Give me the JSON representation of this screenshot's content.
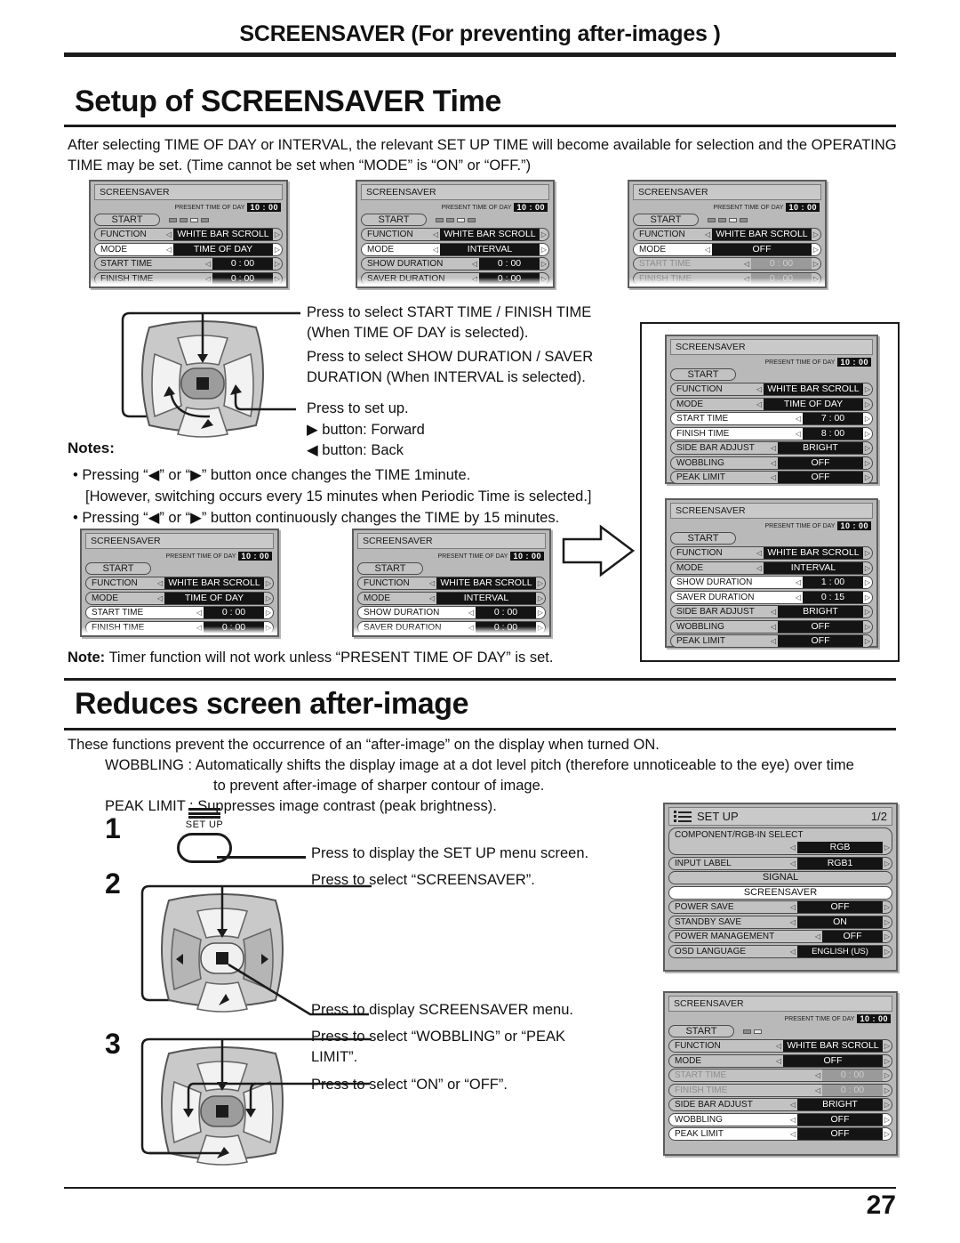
{
  "header": {
    "title": "SCREENSAVER (For preventing after-images )"
  },
  "section1": {
    "heading": "Setup of SCREENSAVER Time",
    "intro": "After selecting TIME OF DAY or INTERVAL, the relevant SET UP TIME will become available for selection and the OPERATING TIME may be set. (Time cannot be set when “MODE” is “ON” or “OFF.”)",
    "callouts": {
      "c1": "Press to select START TIME / FINISH TIME (When TIME OF DAY  is selected).",
      "c2": "Press to select SHOW DURATION / SAVER DURATION (When INTERVAL  is selected).",
      "c3": "Press to set up.",
      "c4": "▶ button: Forward",
      "c5": "◀ button: Back"
    },
    "notes_heading": "Notes:",
    "notes": [
      "• Pressing “◀” or “▶” button once changes the TIME 1minute.",
      "[However, switching occurs every 15 minutes when Periodic Time is selected.]",
      "• Pressing “◀” or “▶” button continuously changes the TIME by 15 minutes."
    ],
    "note_bold": "Note:",
    "note_rest": " Timer function will not work unless “PRESENT TIME OF DAY” is set."
  },
  "section2": {
    "heading": "Reduces screen after-image",
    "lines": [
      "These functions prevent the occurrence of an “after-image” on the display when turned ON.",
      "WOBBLING : Automatically shifts the display image at a dot level pitch (therefore unnoticeable to the eye) over time",
      "to prevent after-image of sharper contour of image.",
      "PEAK LIMIT : Suppresses image contrast (peak brightness)."
    ],
    "steps": [
      {
        "num": "1",
        "callout": "Press to display the SET UP menu screen."
      },
      {
        "num": "2",
        "callout_top": "Press to select “SCREENSAVER”.",
        "callout_bottom": "Press to display SCREENSAVER menu."
      },
      {
        "num": "3",
        "callout_top": "Press to select “WOBBLING” or “PEAK LIMIT”.",
        "callout_bottom": "Press to select “ON” or “OFF”."
      }
    ],
    "setup_button": {
      "label": "SET UP"
    }
  },
  "osd_common": {
    "title": "SCREENSAVER",
    "present_label": "PRESENT TIME OF DAY",
    "present_value": "10 : 00",
    "start_label": "START",
    "labels": {
      "function": "FUNCTION",
      "mode": "MODE",
      "start_time": "START TIME",
      "finish_time": "FINISH TIME",
      "show_duration": "SHOW DURATION",
      "saver_duration": "SAVER DURATION",
      "side_bar_adjust": "SIDE BAR ADJUST",
      "wobbling": "WOBBLING",
      "peak_limit": "PEAK LIMIT"
    },
    "values": {
      "white_bar_scroll": "WHITE BAR SCROLL",
      "time_of_day": "TIME OF DAY",
      "interval": "INTERVAL",
      "off": "OFF",
      "on": "ON",
      "bright": "BRIGHT",
      "zero": "0 : 00",
      "seven": "7 : 00",
      "eight": "8 : 00",
      "one": "1 : 00",
      "fifteen": "0 : 15"
    },
    "arrow_left": "◁",
    "arrow_right": "▷"
  },
  "setup_menu": {
    "title": "SET UP",
    "page": "1/2",
    "rows": [
      {
        "label": "COMPONENT/RGB-IN  SELECT",
        "value": "RGB"
      },
      {
        "label": "INPUT LABEL",
        "value": "RGB1"
      },
      {
        "label": "SIGNAL",
        "value": ""
      },
      {
        "label": "SCREENSAVER",
        "value": ""
      },
      {
        "label": "POWER SAVE",
        "value": "OFF"
      },
      {
        "label": "STANDBY SAVE",
        "value": "ON"
      },
      {
        "label": "POWER MANAGEMENT",
        "value": "OFF"
      },
      {
        "label": "OSD  LANGUAGE",
        "value": "ENGLISH (US)"
      }
    ]
  },
  "footer": {
    "page_number": "27"
  }
}
